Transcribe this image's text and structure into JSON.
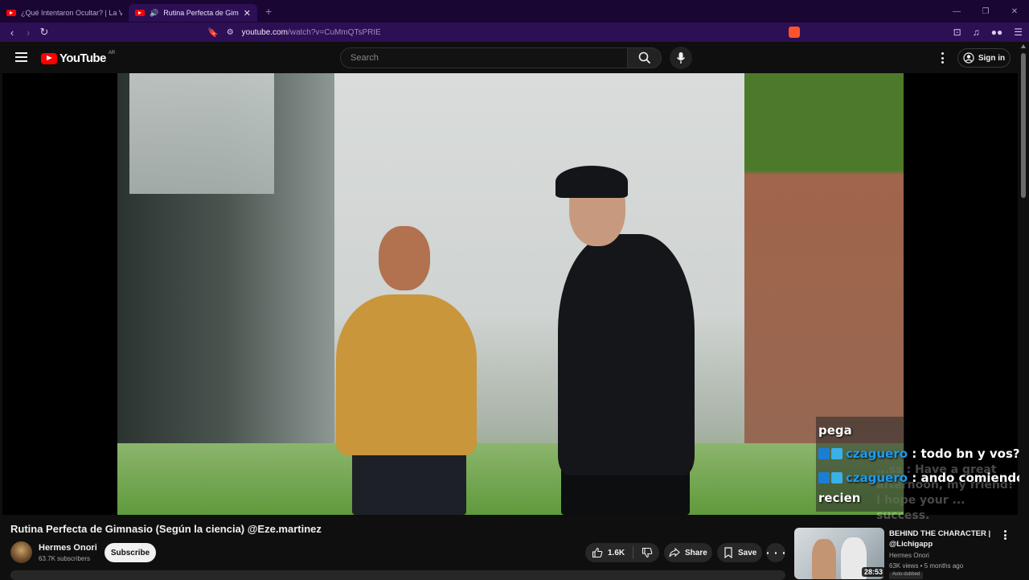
{
  "browser": {
    "tabs": [
      {
        "title": "¿Qué Intentaron Ocultar? | La Verdad",
        "active": false
      },
      {
        "title": "Rutina Perfecta de Gimnasio (",
        "active": true
      }
    ],
    "url_host": "youtube.com",
    "url_path": "/watch?v=CuMmQTsPRIE"
  },
  "masthead": {
    "logo_text": "YouTube",
    "country_code": "AR",
    "search_placeholder": "Search",
    "sign_in_label": "Sign in"
  },
  "chat": {
    "lines": [
      {
        "user": "",
        "message": "pega"
      },
      {
        "user": "czaguero",
        "message": " : todo bn y vos?"
      },
      {
        "user": "czaguero",
        "message": " : ando comiendo"
      },
      {
        "user": "",
        "message": "recien"
      }
    ],
    "ghost_text": "...ss : Have a great afternoon, my friend! I hope your ... success."
  },
  "video": {
    "title": "Rutina Perfecta de Gimnasio (Según la ciencia) @Eze.martinez",
    "channel_name": "Hermes Onori",
    "subscribers": "63.7K subscribers",
    "subscribe_label": "Subscribe",
    "likes": "1.6K",
    "share_label": "Share",
    "save_label": "Save"
  },
  "recommendation": {
    "title": "BEHIND THE CHARACTER | @Lichigapp",
    "channel": "Hermes Onori",
    "meta": "63K views • 5 months ago",
    "duration": "28:53",
    "badge": "Auto-dubbed"
  },
  "colors": {
    "browser_tabstrip": "#1a0633",
    "browser_toolbar": "#2c0f55",
    "yt_red": "#ff0000",
    "chat_username": "#1e9bf0"
  }
}
